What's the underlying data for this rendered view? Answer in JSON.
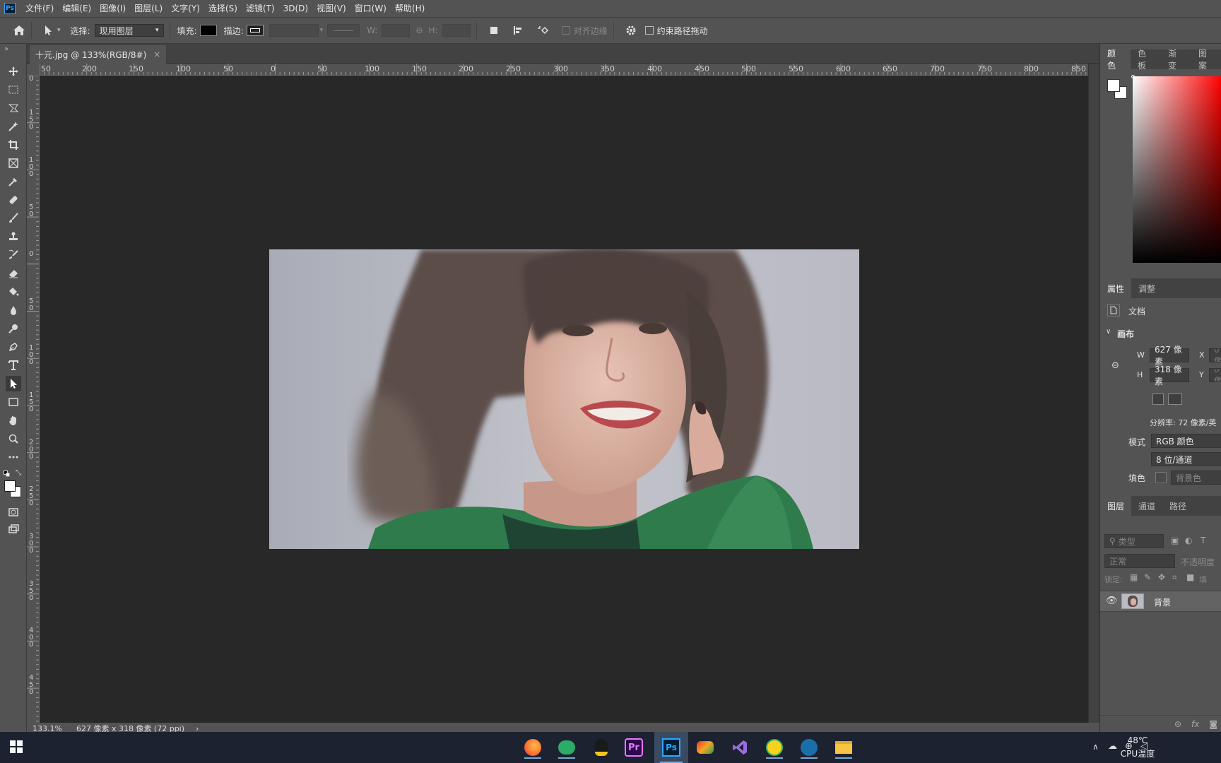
{
  "app": {
    "logo": "Ps",
    "menu": [
      "文件(F)",
      "编辑(E)",
      "图像(I)",
      "图层(L)",
      "文字(Y)",
      "选择(S)",
      "滤镜(T)",
      "3D(D)",
      "视图(V)",
      "窗口(W)",
      "帮助(H)"
    ]
  },
  "options": {
    "select_label": "选择:",
    "select_value": "现用图层",
    "fill_label": "填充:",
    "stroke_label": "描边:",
    "w_label": "W:",
    "h_label": "H:",
    "align_edges": "对齐边缘",
    "constrain_path": "约束路径拖动"
  },
  "document": {
    "tab_title": "十元.jpg @ 133%(RGB/8#)",
    "close_glyph": "×",
    "h_ruler": [
      "50",
      "200",
      "150",
      "100",
      "50",
      "0",
      "50",
      "100",
      "150",
      "200",
      "250",
      "300",
      "350",
      "400",
      "450",
      "500",
      "550",
      "600",
      "650",
      "700",
      "750",
      "800",
      "850"
    ],
    "v_ruler": [
      "0",
      "150",
      "100",
      "50",
      "0",
      "50",
      "100",
      "150",
      "200",
      "250",
      "300",
      "350",
      "400",
      "450"
    ]
  },
  "status": {
    "zoom": "133.1%",
    "info": "627 像素 x 318 像素 (72 ppi)",
    "arrow": "›"
  },
  "panels": {
    "color_tabs": [
      "颜色",
      "色板",
      "渐变",
      "图案"
    ],
    "props_tabs": [
      "属性",
      "调整"
    ],
    "doc_label": "文档",
    "canvas_section": "画布",
    "w_label": "W",
    "w_value": "627 像素",
    "h_label": "H",
    "h_value": "318 像素",
    "x_label": "X",
    "y_label": "Y",
    "x_value": "0 像",
    "y_value": "0 像",
    "resolution": "分辨率: 72 像素/英",
    "mode_label": "模式",
    "mode_value": "RGB 颜色",
    "depth_value": "8 位/通道",
    "fill_label": "填色",
    "fill_value": "背景色",
    "layers_tabs": [
      "图层",
      "通道",
      "路径"
    ],
    "kind_placeholder": "类型",
    "blend_mode": "正常",
    "opacity_label": "不透明度",
    "lock_label": "锁定:",
    "fill_short": "填",
    "layer_name": "背景"
  },
  "taskbar": {
    "temp": "48℃",
    "cpu_label": "CPU温度"
  },
  "colors": {
    "accent": "#31a8ff",
    "ui_dark": "#535353",
    "canvas_bg": "#282828"
  }
}
